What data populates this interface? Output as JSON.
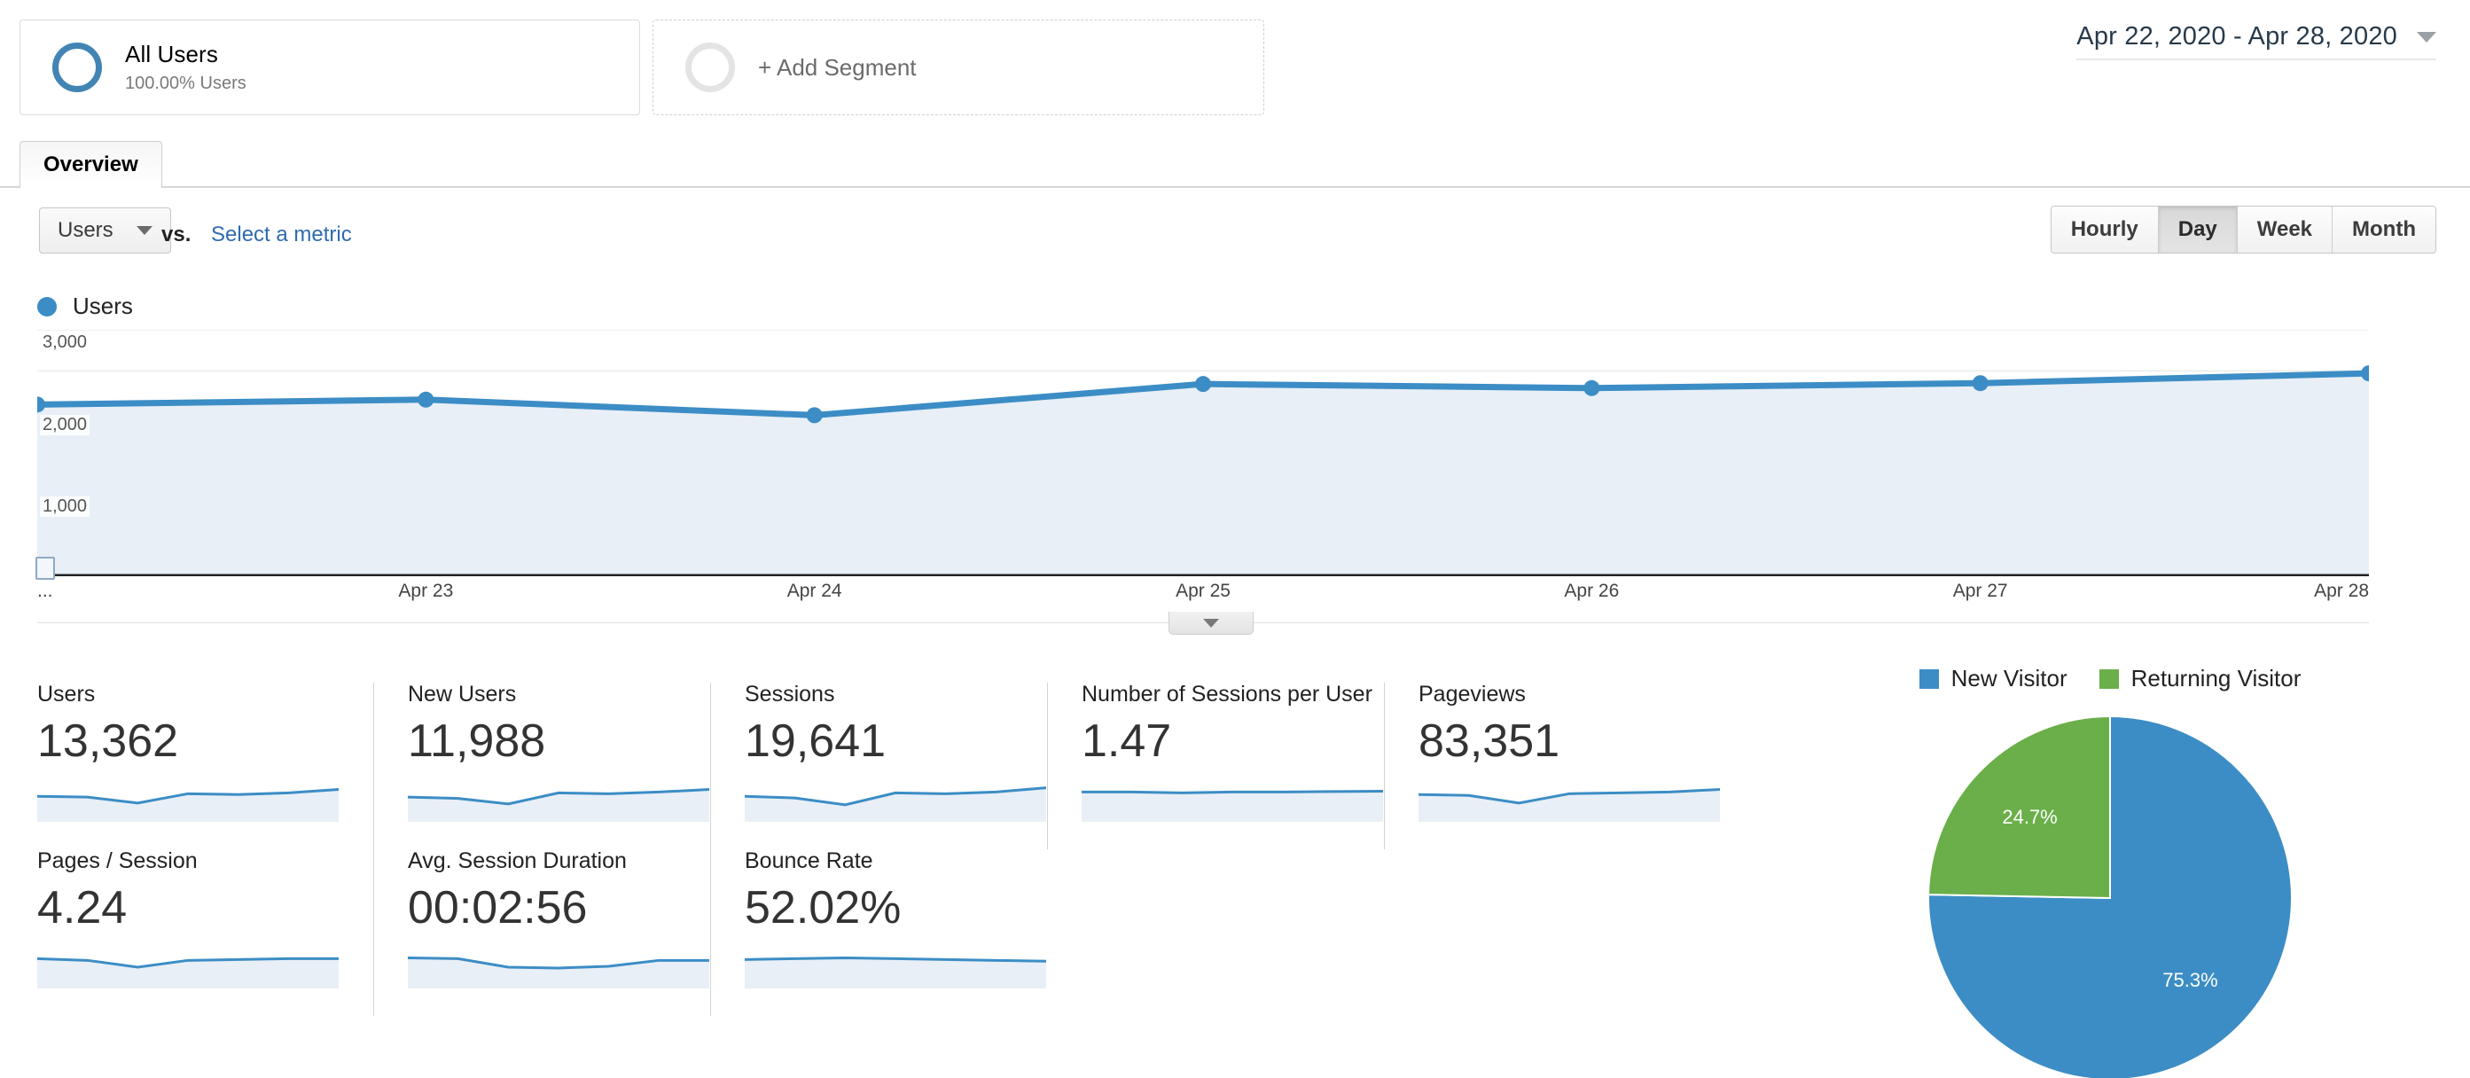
{
  "segment_bar": {
    "all_users": {
      "title": "All Users",
      "subtitle": "100.00% Users",
      "icon": "ring-icon"
    },
    "add_segment": {
      "label": "+ Add Segment",
      "icon": "ring-icon"
    },
    "date_range": {
      "text": "Apr 22, 2020 - Apr 28, 2020",
      "icon": "chevron-down-icon"
    }
  },
  "tabs": [
    {
      "label": "Overview",
      "active": true
    }
  ],
  "controls": {
    "metric_select": {
      "value": "Users",
      "icon": "chevron-down-icon"
    },
    "vs_label": "vs.",
    "select_metric_link": "Select a metric",
    "granularity": [
      {
        "label": "Hourly",
        "active": false
      },
      {
        "label": "Day",
        "active": true
      },
      {
        "label": "Week",
        "active": false
      },
      {
        "label": "Month",
        "active": false
      }
    ]
  },
  "chart_data": [
    {
      "type": "line",
      "title": "Users",
      "legend": [
        "Users"
      ],
      "legend_position": "top-left",
      "xlabel": "",
      "ylabel": "",
      "grid": true,
      "ylim": [
        0,
        3000
      ],
      "yticks": [
        1000,
        2000,
        3000
      ],
      "ytick_labels": [
        "1,000",
        "2,000",
        "3,000"
      ],
      "x": [
        "...",
        "Apr 23",
        "Apr 24",
        "Apr 25",
        "Apr 26",
        "Apr 27",
        "Apr 28"
      ],
      "series": [
        {
          "name": "Users",
          "color": "#3c8dc5",
          "fill": "#e8eff7",
          "values": [
            2090,
            2150,
            1960,
            2340,
            2290,
            2350,
            2470
          ]
        }
      ]
    },
    {
      "type": "pie",
      "title": "",
      "legend_position": "top",
      "labels": [
        "New Visitor",
        "Returning Visitor"
      ],
      "values": [
        75.3,
        24.7
      ],
      "value_labels": [
        "75.3%",
        "24.7%"
      ],
      "colors": [
        "#3c8dc5",
        "#6aaf4a"
      ]
    }
  ],
  "metrics": {
    "row1": [
      {
        "label": "Users",
        "value": "13,362",
        "spark": [
          60,
          58,
          44,
          66,
          64,
          68,
          76
        ]
      },
      {
        "label": "New Users",
        "value": "11,988",
        "spark": [
          58,
          55,
          42,
          68,
          66,
          70,
          76
        ]
      },
      {
        "label": "Sessions",
        "value": "19,641",
        "spark": [
          60,
          56,
          40,
          68,
          66,
          70,
          80
        ]
      },
      {
        "label": "Number of Sessions per User",
        "value": "1.47",
        "spark": [
          70,
          70,
          68,
          70,
          70,
          71,
          72
        ]
      },
      {
        "label": "Pageviews",
        "value": "83,351",
        "spark": [
          64,
          62,
          44,
          66,
          68,
          70,
          76
        ]
      }
    ],
    "row2": [
      {
        "label": "Pages / Session",
        "value": "4.24",
        "spark": [
          70,
          66,
          50,
          66,
          68,
          70,
          70
        ]
      },
      {
        "label": "Avg. Session Duration",
        "value": "00:02:56",
        "spark": [
          72,
          70,
          50,
          48,
          52,
          66,
          66
        ]
      },
      {
        "label": "Bounce Rate",
        "value": "52.02%",
        "spark": [
          68,
          70,
          72,
          70,
          68,
          66,
          64
        ]
      }
    ]
  },
  "icons": {
    "annotation": "annotation-icon",
    "chart_collapse": "chevron-down-icon"
  },
  "colors": {
    "accent_blue": "#3c8dc5",
    "green": "#6aaf4a",
    "link_blue": "#2e6bb0",
    "area_fill": "#e8eff7"
  }
}
